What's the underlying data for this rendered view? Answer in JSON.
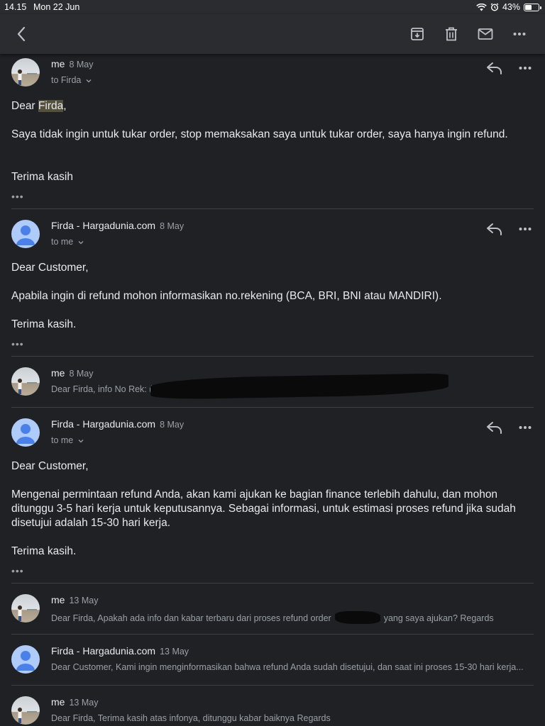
{
  "status_bar": {
    "time": "14.15",
    "date": "Mon 22 Jun",
    "battery": "43%",
    "battery_level": 0.43
  },
  "toolbar": {
    "icons": [
      "back-icon",
      "archive-icon",
      "trash-icon",
      "mail-icon",
      "more-icon"
    ]
  },
  "messages": [
    {
      "sender": "me",
      "date": "8 May",
      "to": "to Firda",
      "greeting_prefix": "Dear ",
      "greeting_name": "Firda",
      "greeting_suffix": ",",
      "body": "Saya tidak ingin untuk tukar order, stop memaksakan saya untuk tukar order, saya hanya ingin refund.",
      "closing": "Terima kasih"
    },
    {
      "sender": "Firda - Hargadunia.com",
      "date": "8 May",
      "to": "to me",
      "greeting": "Dear Customer,",
      "body": "Apabila ingin di refund mohon informasikan no.rekening (BCA, BRI, BNI atau MANDIRI).",
      "closing": "Terima kasih."
    },
    {
      "sender": "me",
      "date": "8 May",
      "snippet": "Dear Firda, info No Rek: ("
    },
    {
      "sender": "Firda - Hargadunia.com",
      "date": "8 May",
      "to": "to me",
      "greeting": "Dear Customer,",
      "body": "Mengenai permintaan refund Anda, akan kami ajukan ke bagian finance terlebih dahulu, dan mohon ditunggu 3-5 hari kerja untuk keputusannya. Sebagai informasi, untuk estimasi proses refund jika sudah disetujui adalah 15-30 hari kerja.",
      "closing": "Terima kasih."
    },
    {
      "sender": "me",
      "date": "13 May",
      "snippet_before": "Dear Firda, Apakah ada info dan kabar terbaru dari proses refund order",
      "snippet_after": "yang saya ajukan? Regards"
    },
    {
      "sender": "Firda - Hargadunia.com",
      "date": "13 May",
      "snippet": "Dear Customer, Kami ingin menginformasikan bahwa refund Anda sudah disetujui, dan saat ini proses 15-30 hari kerja..."
    },
    {
      "sender": "me",
      "date": "13 May",
      "snippet": "Dear Firda, Terima kasih atas infonya, ditunggu kabar baiknya Regards"
    }
  ],
  "colors": {
    "background": "#202124",
    "toolbar": "#2b2c30",
    "firda_avatar": "#aecbfa",
    "firda_avatar_figure": "#4a80e8",
    "highlight": "#54503b"
  }
}
